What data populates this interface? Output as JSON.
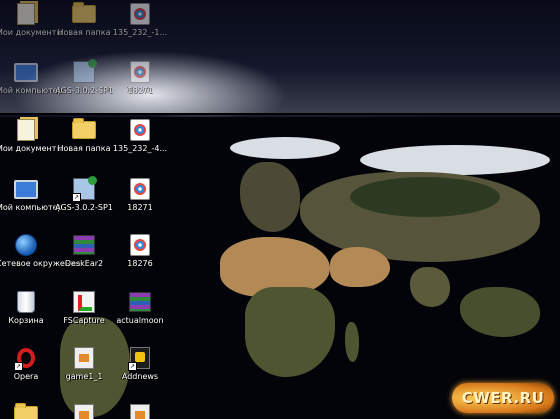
{
  "ghost_row": [
    {
      "label": "Мои документы",
      "icon": "documents-folder-icon"
    },
    {
      "label": "Новая папка",
      "icon": "folder-icon"
    },
    {
      "label": "135_232_-1...",
      "icon": "media-file-icon"
    },
    {
      "label": "Мой компьютер",
      "icon": "my-computer-icon"
    },
    {
      "label": "AGS-3.0.2-SP1",
      "icon": "installer-icon"
    },
    {
      "label": "18271",
      "icon": "media-file-icon"
    }
  ],
  "icons": [
    {
      "label": "Мои документы",
      "icon": "documents-folder-icon"
    },
    {
      "label": "Новая папка",
      "icon": "folder-icon"
    },
    {
      "label": "135_232_-4...",
      "icon": "media-file-icon"
    },
    {
      "label": "Мой компьютер",
      "icon": "my-computer-icon"
    },
    {
      "label": "AGS-3.0.2-SP1",
      "icon": "installer-icon"
    },
    {
      "label": "18271",
      "icon": "media-file-icon"
    },
    {
      "label": "Сетевое окружение",
      "icon": "network-globe-icon"
    },
    {
      "label": "DeskEar2",
      "icon": "archive-icon"
    },
    {
      "label": "18276",
      "icon": "media-file-icon"
    },
    {
      "label": "Корзина",
      "icon": "recycle-bin-icon"
    },
    {
      "label": "FSCapture",
      "icon": "fscapture-icon"
    },
    {
      "label": "actualmoon",
      "icon": "archive-icon"
    },
    {
      "label": "Opera",
      "icon": "opera-icon"
    },
    {
      "label": "game1_1",
      "icon": "executable-icon"
    },
    {
      "label": "Addnews",
      "icon": "addnews-icon"
    }
  ],
  "watermark": "CWER.RU"
}
